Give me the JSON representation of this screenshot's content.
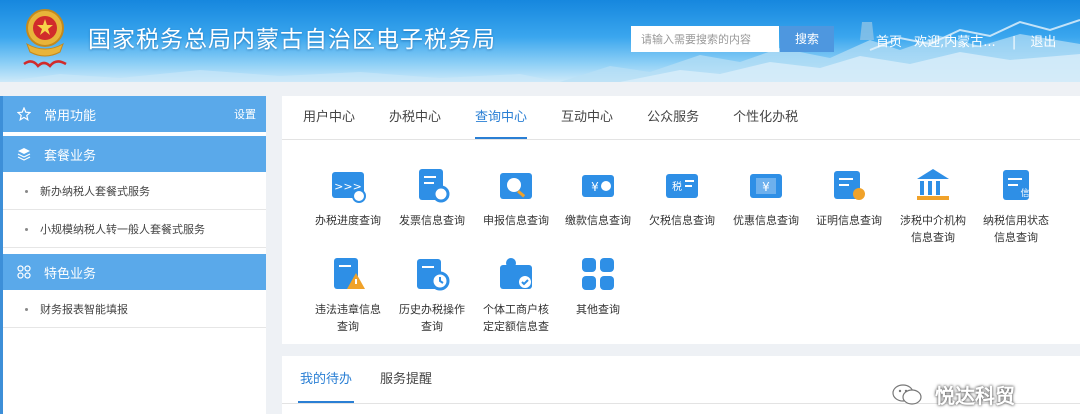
{
  "header": {
    "emblem_text": "中国税务",
    "title": "国家税务总局内蒙古自治区电子税务局",
    "search_placeholder": "请输入需要搜索的内容",
    "search_button": "搜索",
    "home_link": "首页",
    "welcome": "欢迎,内蒙古...",
    "separator": "|",
    "logout": "退出"
  },
  "sidebar": {
    "common": {
      "label": "常用功能",
      "settings": "设置",
      "icon": "star-outline-icon"
    },
    "package": {
      "label": "套餐业务",
      "icon": "layers-icon",
      "items": [
        "新办纳税人套餐式服务",
        "小规模纳税人转一般人套餐式服务"
      ]
    },
    "special": {
      "label": "特色业务",
      "icon": "grid-icon",
      "items": [
        "财务报表智能填报"
      ]
    }
  },
  "main": {
    "tabs": [
      "用户中心",
      "办税中心",
      "查询中心",
      "互动中心",
      "公众服务",
      "个性化办税"
    ],
    "active_tab": "查询中心",
    "tiles": [
      {
        "line1": "办税进度查询",
        "line2": "",
        "icon": "progress-query-icon"
      },
      {
        "line1": "发票信息查询",
        "line2": "",
        "icon": "invoice-query-icon"
      },
      {
        "line1": "申报信息查询",
        "line2": "",
        "icon": "declaration-query-icon"
      },
      {
        "line1": "缴款信息查询",
        "line2": "",
        "icon": "payment-query-icon"
      },
      {
        "line1": "欠税信息查询",
        "line2": "",
        "icon": "tax-arrears-query-icon"
      },
      {
        "line1": "优惠信息查询",
        "line2": "",
        "icon": "preferential-query-icon"
      },
      {
        "line1": "证明信息查询",
        "line2": "",
        "icon": "certificate-query-icon"
      },
      {
        "line1": "涉税中介机构",
        "line2": "信息查询",
        "icon": "agency-query-icon"
      },
      {
        "line1": "纳税信用状态",
        "line2": "信息查询",
        "icon": "credit-status-icon"
      },
      {
        "line1": "违法违章信息",
        "line2": "查询",
        "icon": "violation-query-icon"
      },
      {
        "line1": "历史办税操作",
        "line2": "查询",
        "icon": "history-query-icon"
      },
      {
        "line1": "个体工商户核",
        "line2": "定定额信息查",
        "icon": "individual-business-icon"
      },
      {
        "line1": "其他查询",
        "line2": "",
        "icon": "other-query-icon"
      }
    ]
  },
  "bottom": {
    "tabs": [
      "我的待办",
      "服务提醒"
    ],
    "active_tab": "我的待办"
  },
  "watermark": "悦达科贸",
  "colors": {
    "accent": "#2a7fd4",
    "sidebar_head": "#5aa9ea",
    "icon_blue": "#2e8fe6",
    "icon_orange": "#f0a22a"
  }
}
